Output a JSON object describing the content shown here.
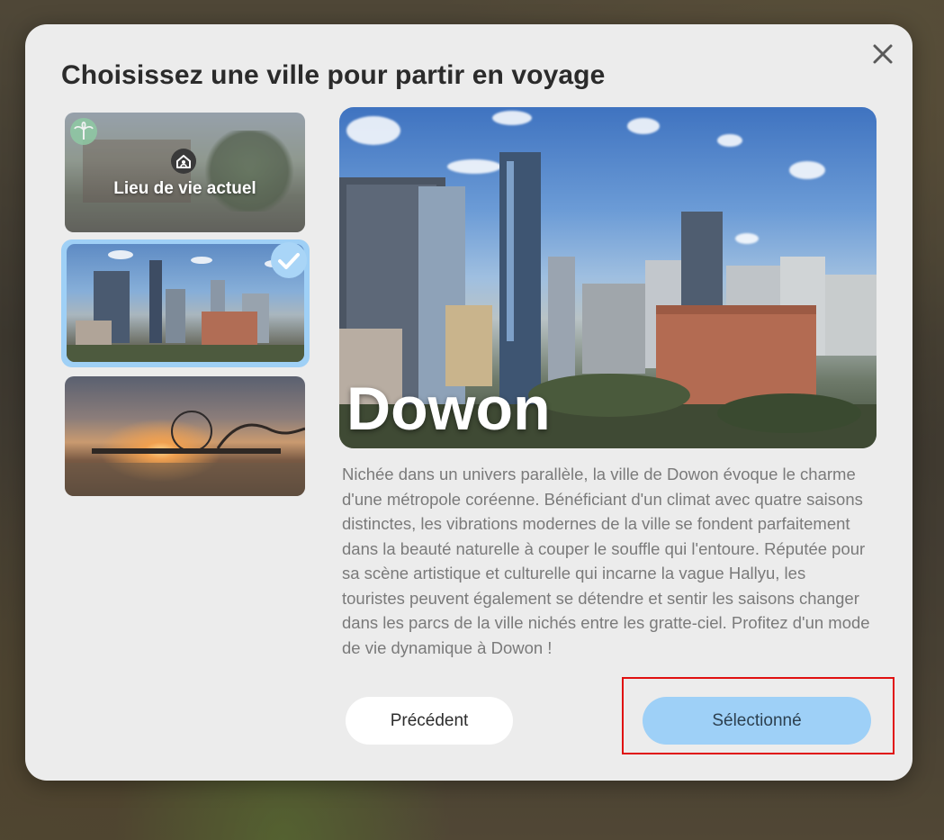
{
  "dialog": {
    "title": "Choisissez une ville pour partir en voyage",
    "close_icon": "close-icon"
  },
  "cities": [
    {
      "label": "Lieu de vie actuel",
      "icon": "home-icon",
      "badge": "palm-tree-icon",
      "selected": false,
      "current": true
    },
    {
      "label": "",
      "icon": "check-icon",
      "selected": true
    },
    {
      "label": "",
      "selected": false
    }
  ],
  "detail": {
    "city_name": "Dowon",
    "description": "Nichée dans un univers parallèle, la ville de Dowon évoque le charme d'une métropole coréenne. Bénéficiant d'un climat avec quatre saisons distinctes, les vibrations modernes de la ville se fondent parfaitement dans la beauté naturelle à couper le souffle qui l'entoure. Réputée pour sa scène artistique et culturelle qui incarne la vague Hallyu, les touristes peuvent également se détendre et sentir les saisons changer dans les parcs de la ville nichés entre les gratte-ciel. Profitez d'un mode de vie dynamique à Dowon !"
  },
  "buttons": {
    "previous": "Précédent",
    "select": "Sélectionné"
  },
  "colors": {
    "modal_bg": "#ececec",
    "accent": "#9ed0f7",
    "highlight": "#e01010",
    "text_muted": "#7a7a7a"
  }
}
